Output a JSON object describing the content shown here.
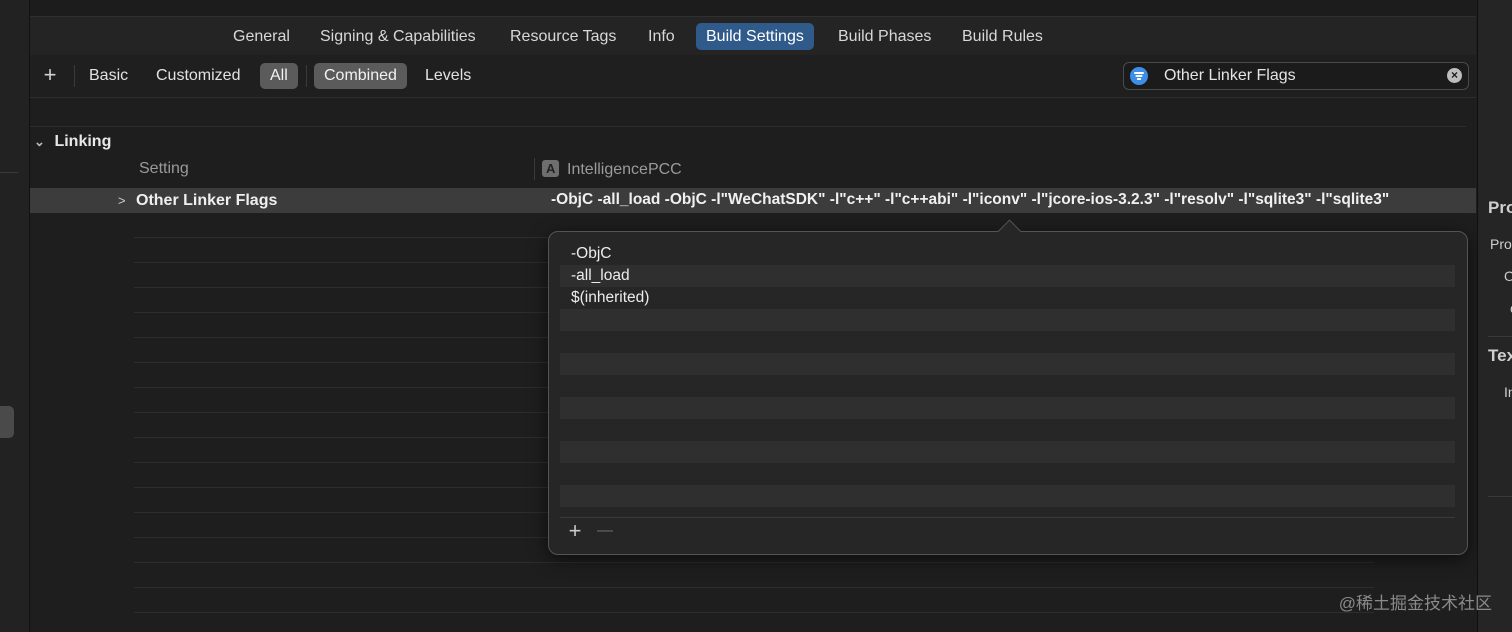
{
  "tabs": [
    "General",
    "Signing & Capabilities",
    "Resource Tags",
    "Info",
    "Build Settings",
    "Build Phases",
    "Build Rules"
  ],
  "active_tab": "Build Settings",
  "filter_bar": {
    "add_label": "+",
    "basic": "Basic",
    "customized": "Customized",
    "all": "All",
    "combined": "Combined",
    "levels": "Levels"
  },
  "search": {
    "value": "Other Linker Flags",
    "clear_icon": "clear-icon"
  },
  "section": {
    "title": "Linking"
  },
  "columns": {
    "setting": "Setting",
    "target": "IntelligencePCC"
  },
  "setting_row": {
    "name": "Other Linker Flags",
    "value": "-ObjC -all_load  -ObjC -l\"WeChatSDK\" -l\"c++\" -l\"c++abi\" -l\"iconv\" -l\"jcore-ios-3.2.3\" -l\"resolv\" -l\"sqlite3\" -l\"sqlite3\""
  },
  "popover": {
    "items": [
      "-ObjC",
      "-all_load",
      "$(inherited)"
    ],
    "add_label": "+",
    "remove_label": "—"
  },
  "right_panel": [
    "Pro",
    "Pro",
    "O",
    "c",
    "Tex",
    "In"
  ],
  "watermark": "@稀土掘金技术社区",
  "colors": {
    "accent": "#2f5a8a",
    "selected_row": "#3c3c3c",
    "filter_icon": "#3d8ee6"
  }
}
